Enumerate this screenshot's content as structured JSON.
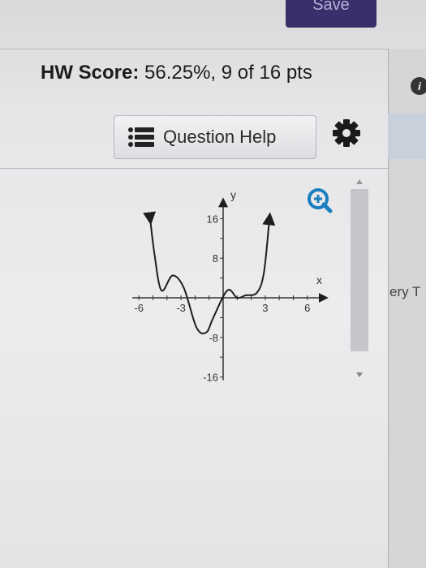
{
  "header": {
    "save_label": "Save"
  },
  "score": {
    "label": "HW Score:",
    "value": "56.25%, 9 of 16 pts"
  },
  "help": {
    "label": "Question Help"
  },
  "side": {
    "info_icon_letter": "i",
    "edge_text": "ery T"
  },
  "graph": {
    "x_axis_label": "x",
    "y_axis_label": "y",
    "x_ticks": [
      "-6",
      "-3",
      "3",
      "6"
    ],
    "y_ticks": [
      "16",
      "8",
      "-8",
      "-16"
    ]
  },
  "chart_data": {
    "type": "line",
    "xlabel": "x",
    "ylabel": "y",
    "xlim": [
      -6,
      6
    ],
    "ylim": [
      -16,
      16
    ],
    "arrows_on_ends": true,
    "series": [
      {
        "x": [
          -5.2,
          -4.9,
          -4.4,
          -3.6,
          -2.8,
          -1.9,
          -1.2,
          -0.7,
          0.3,
          1.0,
          1.6,
          2.4,
          2.9,
          3.3
        ],
        "y": [
          16,
          9,
          1.5,
          4.5,
          2,
          -6,
          -7,
          -4,
          1.5,
          0,
          0.5,
          1,
          5,
          16
        ]
      }
    ],
    "colors": {
      "curve": "#1e1e1e",
      "axes": "#333333",
      "zoom": "#1a7fbf"
    }
  }
}
